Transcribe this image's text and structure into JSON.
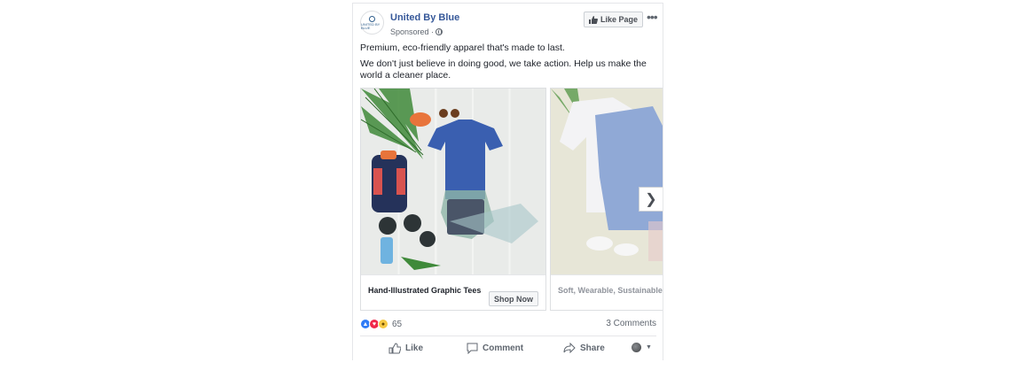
{
  "post": {
    "page_name": "United By Blue",
    "sponsored": "Sponsored ·",
    "like_page": "Like Page",
    "more": "•••",
    "avatar_text": "UNITED BY BLUE",
    "text_line1": "Premium, eco-friendly apparel that's made to last.",
    "text_line2": "We don't just believe in doing good, we take action. Help us make the world a cleaner place."
  },
  "carousel": {
    "cards": [
      {
        "title": "Hand-Illustrated Graphic Tees",
        "cta": "Shop Now"
      },
      {
        "title": "Soft, Wearable, Sustainable"
      }
    ],
    "next_icon": "chevron-right-icon"
  },
  "stats": {
    "reaction_count": "65",
    "comments": "3 Comments"
  },
  "actions": {
    "like": "Like",
    "comment": "Comment",
    "share": "Share"
  },
  "colors": {
    "link_blue": "#365899",
    "reaction_like": "#2f7bf6",
    "reaction_love": "#f0284a",
    "reaction_wow": "#f6c944"
  }
}
